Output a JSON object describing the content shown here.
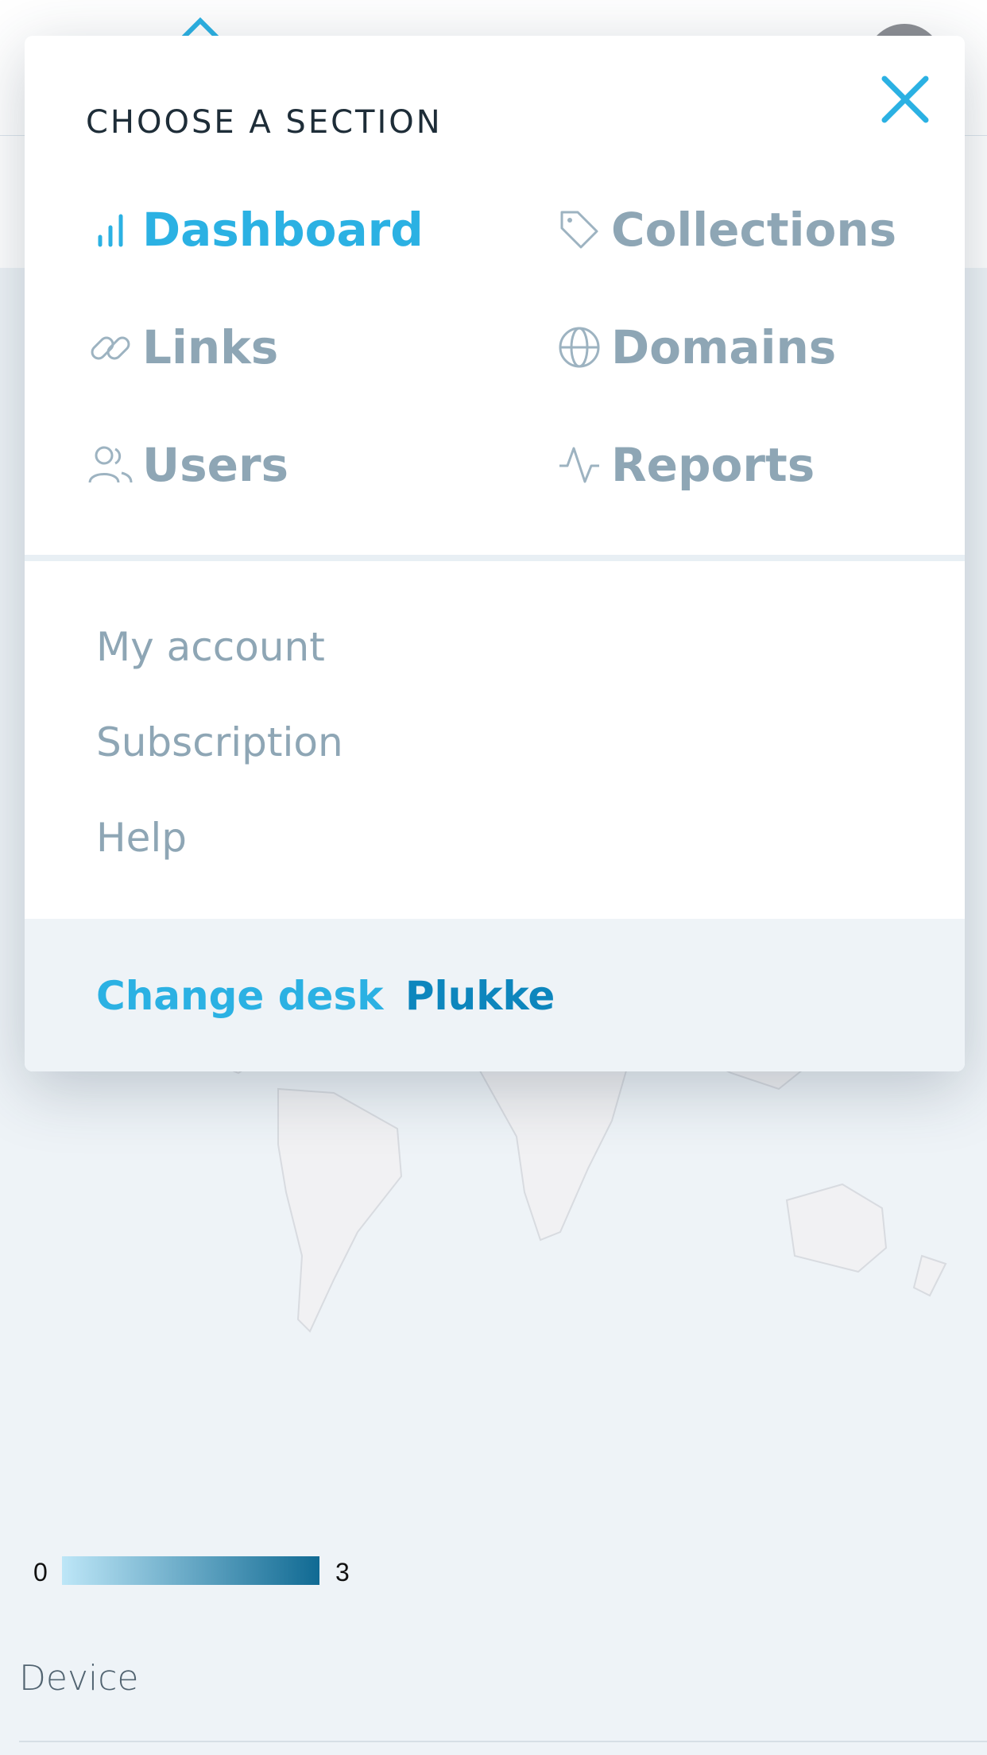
{
  "menu": {
    "title": "CHOOSE A SECTION",
    "sections": [
      {
        "label": "Dashboard",
        "icon": "bar-chart-icon",
        "active": true
      },
      {
        "label": "Collections",
        "icon": "tag-icon",
        "active": false
      },
      {
        "label": "Links",
        "icon": "link-icon",
        "active": false
      },
      {
        "label": "Domains",
        "icon": "globe-icon",
        "active": false
      },
      {
        "label": "Users",
        "icon": "users-icon",
        "active": false
      },
      {
        "label": "Reports",
        "icon": "activity-icon",
        "active": false
      }
    ],
    "account_links": [
      {
        "label": "My account"
      },
      {
        "label": "Subscription"
      },
      {
        "label": "Help"
      }
    ],
    "desk": {
      "change_label": "Change desk",
      "current": "Plukke"
    }
  },
  "background": {
    "legend": {
      "min": "0",
      "max": "3"
    },
    "device_label": "Device"
  },
  "colors": {
    "accent": "#2bb1e3",
    "muted": "#8ea6b5",
    "desk_name": "#0d86bd",
    "map_highlight": "#0f5f86"
  }
}
